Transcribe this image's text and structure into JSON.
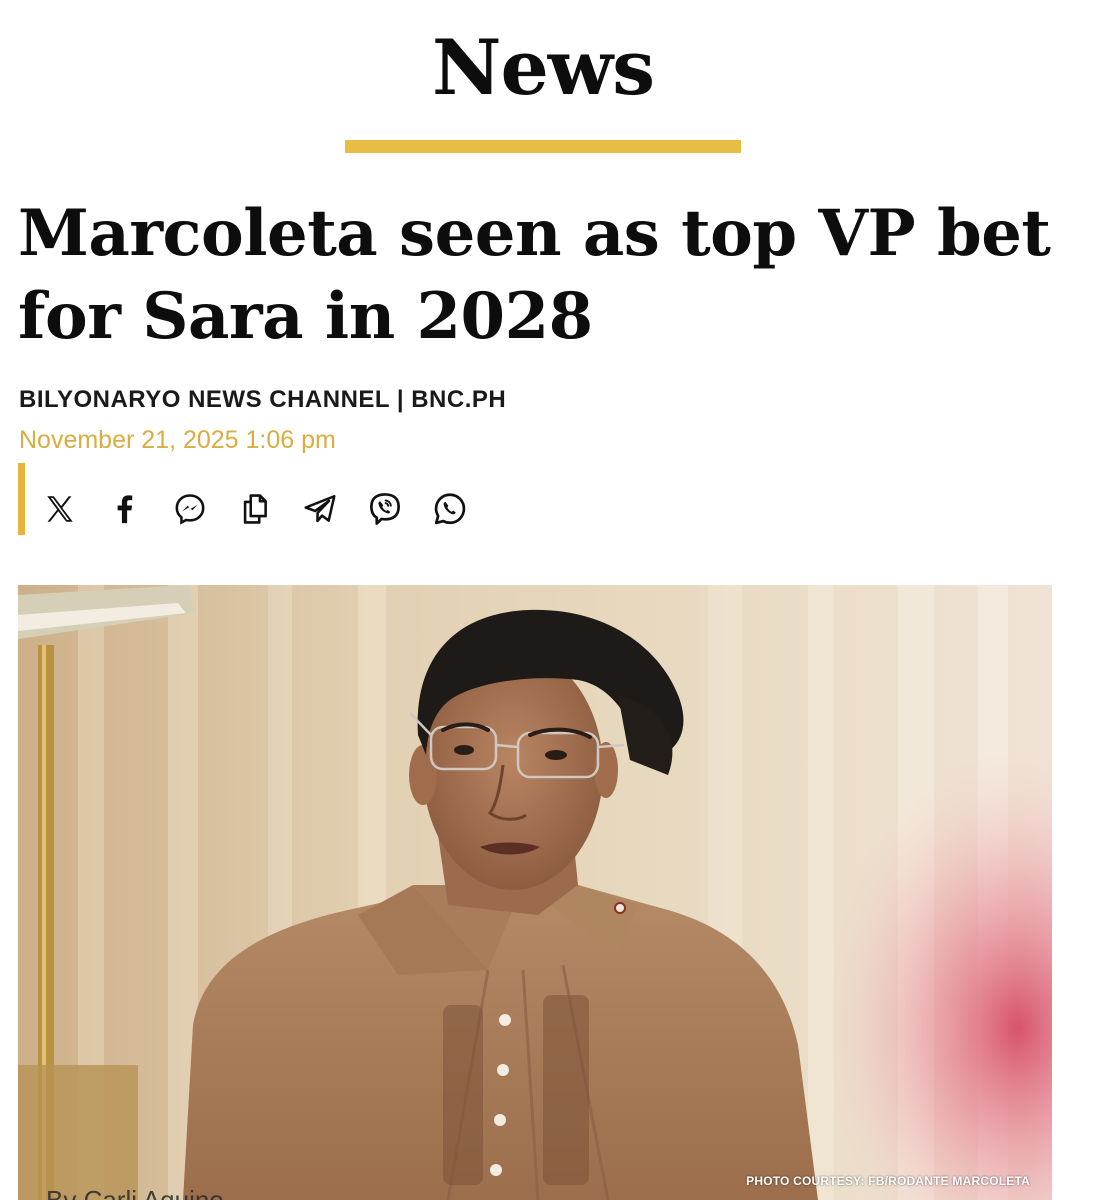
{
  "section": {
    "title": "News",
    "accent_color": "#e9bc45"
  },
  "article": {
    "headline": "Marcoleta seen as top VP bet for Sara in 2028",
    "byline": "BILYONARYO NEWS CHANNEL | BNC.PH",
    "date": "November 21, 2025 1:06 pm",
    "date_color": "#d9ad42"
  },
  "share": {
    "icons": [
      {
        "name": "x-icon"
      },
      {
        "name": "facebook-icon"
      },
      {
        "name": "messenger-icon"
      },
      {
        "name": "copy-link-icon"
      },
      {
        "name": "telegram-icon"
      },
      {
        "name": "viber-icon"
      },
      {
        "name": "whatsapp-icon"
      }
    ]
  },
  "hero": {
    "photo_credit": "PHOTO COURTESY: FB/RODANTE MARCOLETA",
    "author_peek": "By Carli Aquino"
  }
}
